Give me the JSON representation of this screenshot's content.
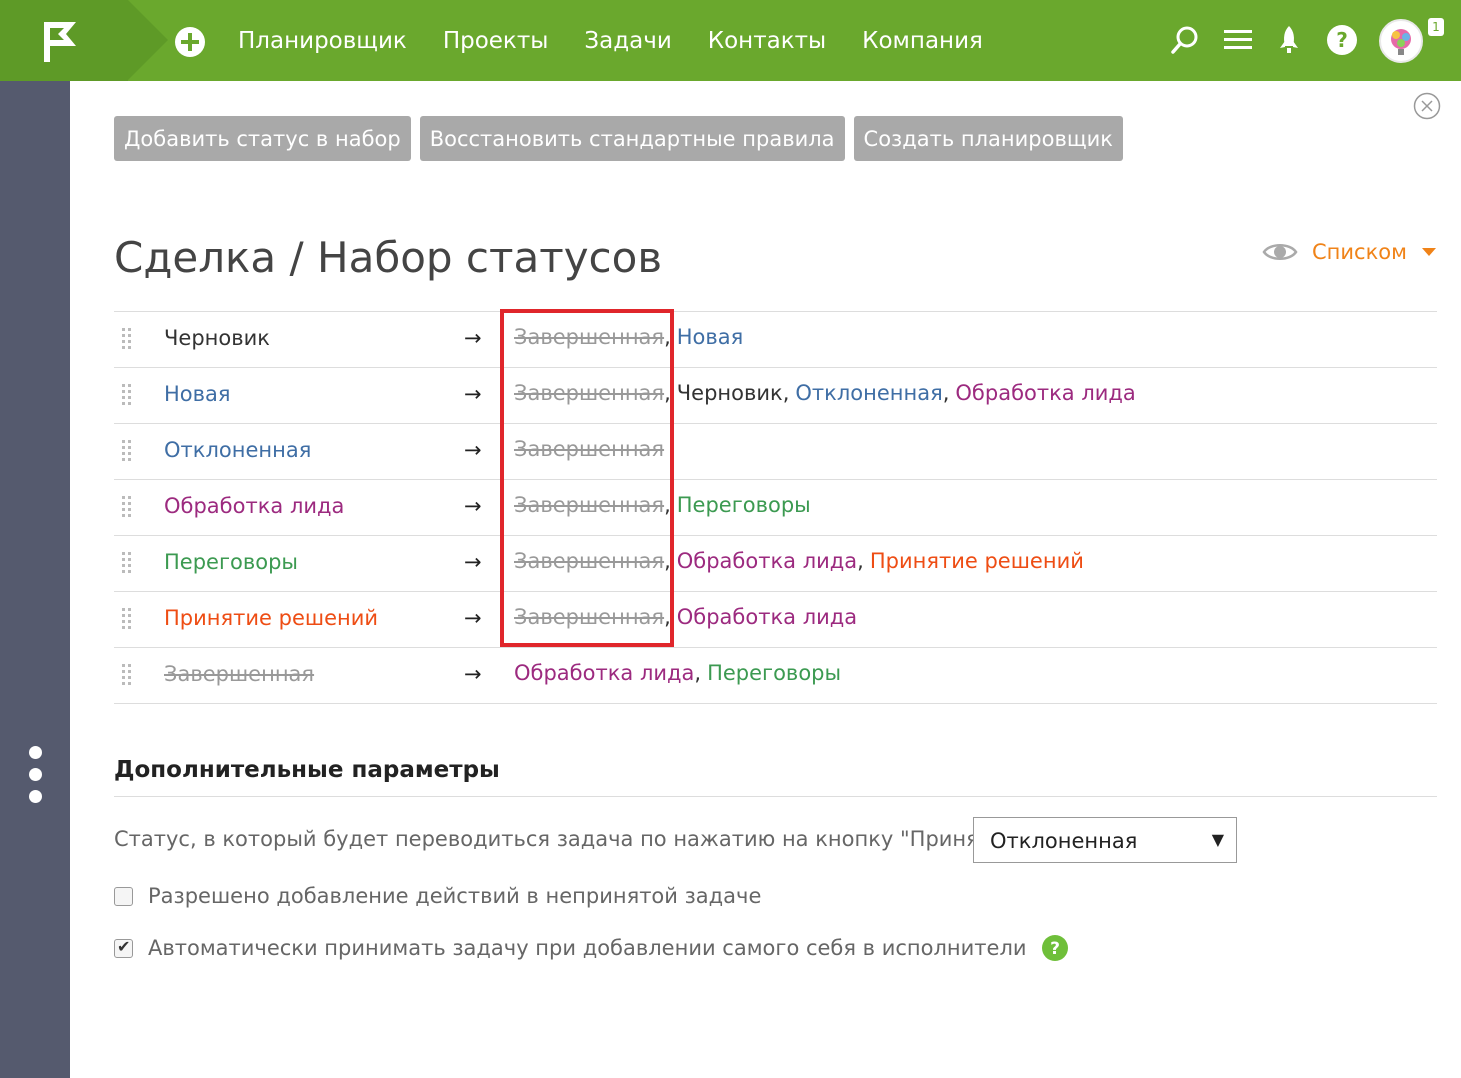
{
  "nav": {
    "items": [
      "Планировщик",
      "Проекты",
      "Задачи",
      "Контакты",
      "Компания"
    ],
    "badge": "1"
  },
  "icons": {
    "logo": "flag-logo-icon",
    "add": "plus-circle-icon",
    "search": "search-icon",
    "menu": "hamburger-icon",
    "rocket": "rocket-icon",
    "help": "help-icon",
    "close": "close-icon",
    "eye": "eye-icon"
  },
  "colors": {
    "topbar": "#6aa82d",
    "sidebar": "#555a6e",
    "button": "#a9a9a9",
    "accent": "#f08318",
    "highlight": "#e0262b"
  },
  "toolbar": {
    "add_status": "Добавить статус в набор",
    "restore_rules": "Восстановить стандартные правила",
    "create_planner": "Создать планировщик"
  },
  "page": {
    "title": "Сделка / Набор статусов",
    "view_label": "Списком"
  },
  "statuses": {
    "rows": [
      {
        "from": "Черновик",
        "from_style": "black",
        "to": [
          {
            "t": "Завершенная",
            "s": "gray"
          },
          {
            "t": "Новая",
            "s": "blue"
          }
        ]
      },
      {
        "from": "Новая",
        "from_style": "blue",
        "to": [
          {
            "t": "Завершенная",
            "s": "gray"
          },
          {
            "t": "Черновик",
            "s": "black"
          },
          {
            "t": "Отклоненная",
            "s": "blue"
          },
          {
            "t": "Обработка лида",
            "s": "purple"
          }
        ]
      },
      {
        "from": "Отклоненная",
        "from_style": "blue",
        "to": [
          {
            "t": "Завершенная",
            "s": "gray"
          }
        ]
      },
      {
        "from": "Обработка лида",
        "from_style": "purple",
        "to": [
          {
            "t": "Завершенная",
            "s": "gray"
          },
          {
            "t": "Переговоры",
            "s": "green"
          }
        ]
      },
      {
        "from": "Переговоры",
        "from_style": "green",
        "to": [
          {
            "t": "Завершенная",
            "s": "gray"
          },
          {
            "t": "Обработка лида",
            "s": "purple"
          },
          {
            "t": "Принятие решений",
            "s": "orange"
          }
        ]
      },
      {
        "from": "Принятие решений",
        "from_style": "orange",
        "to": [
          {
            "t": "Завершенная",
            "s": "gray"
          },
          {
            "t": "Обработка лида",
            "s": "purple"
          }
        ]
      },
      {
        "from": "Завершенная",
        "from_style": "gray",
        "to": [
          {
            "t": "Обработка лида",
            "s": "purple"
          },
          {
            "t": "Переговоры",
            "s": "green"
          }
        ]
      }
    ],
    "arrow": "→",
    "separator": ","
  },
  "params": {
    "title": "Дополнительные параметры",
    "accept_label": "Статус, в который будет переводиться задача по нажатию на кнопку \"Принять\":",
    "accept_value": "Отклоненная",
    "select_arrow": "▼",
    "allow_actions_label": "Разрешено добавление действий в непринятой задаче",
    "allow_actions_checked": false,
    "auto_accept_label": "Автоматически принимать задачу при добавлении самого себя в исполнители",
    "auto_accept_checked": true
  }
}
